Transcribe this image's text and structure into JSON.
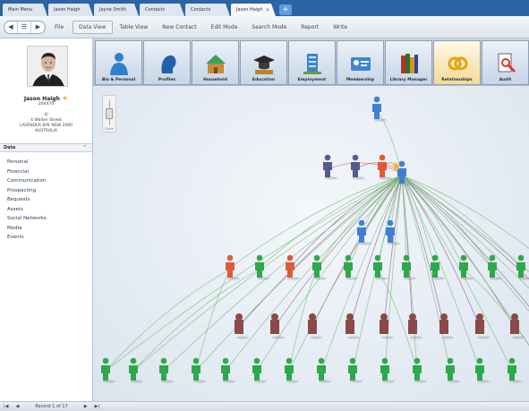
{
  "tabs": [
    {
      "label": "Main Menu",
      "active": false
    },
    {
      "label": "Jason Haigh",
      "active": false
    },
    {
      "label": "Jayne Smith",
      "active": false
    },
    {
      "label": "Contacts",
      "active": false
    },
    {
      "label": "Contacts",
      "active": false
    },
    {
      "label": "Jason Haigh",
      "active": true
    }
  ],
  "toolbar": {
    "file": "File",
    "items": [
      "Data View",
      "Table View",
      "New Contact",
      "Edit Mode",
      "Search Mode",
      "Report",
      "Write"
    ]
  },
  "person": {
    "name": "Jason Haigh",
    "id": "204470",
    "address_line1": "4/",
    "address_line2": "4 Walker Street",
    "address_line3": "LAVENDER BAY NSW 2060",
    "address_line4": "AUSTRALIA"
  },
  "data_section": {
    "header": "Data",
    "items": [
      "Personal",
      "Financial",
      "Communication",
      "Prospecting",
      "Bequests",
      "Assets",
      "Social Networks",
      "Media",
      "Events"
    ]
  },
  "ribbon": {
    "buttons": [
      {
        "label": "Bio & Personal",
        "icon": "bio-personal-icon"
      },
      {
        "label": "Profiles",
        "icon": "profiles-icon"
      },
      {
        "label": "Household",
        "icon": "household-icon"
      },
      {
        "label": "Education",
        "icon": "education-icon"
      },
      {
        "label": "Employment",
        "icon": "employment-icon"
      },
      {
        "label": "Membership",
        "icon": "membership-icon"
      },
      {
        "label": "Library Manager",
        "icon": "library-manager-icon"
      },
      {
        "label": "Relationships",
        "icon": "relationships-icon",
        "active": true
      },
      {
        "label": "Audit",
        "icon": "audit-icon"
      }
    ]
  },
  "zoom_label": "Zoom",
  "status": {
    "record": "Record 1 of 17"
  },
  "colors": {
    "person_blue": "#3f7fd6",
    "person_red": "#e05a3a",
    "person_green": "#2ea84a",
    "person_dark": "#8a4a4a",
    "person_navy": "#555a8a",
    "relationship_green": "#6bb86a",
    "relationship_purple": "#8c4c8c",
    "relationship_red": "#d05050",
    "tab_bar": "#2d64a3",
    "highlight_star": "#f2b01e"
  },
  "graph_nodes": [
    {
      "type": "person",
      "color": "blue"
    },
    {
      "type": "person",
      "color": "navy"
    },
    {
      "type": "person",
      "color": "navy"
    },
    {
      "type": "person",
      "color": "red"
    },
    {
      "type": "person",
      "color": "blue",
      "starred": true
    },
    {
      "type": "person",
      "color": "blue"
    },
    {
      "type": "person",
      "color": "blue"
    },
    {
      "type": "person",
      "color": "red"
    },
    {
      "type": "person",
      "color": "green"
    },
    {
      "type": "person",
      "color": "red"
    },
    {
      "type": "person",
      "color": "green"
    },
    {
      "type": "person",
      "color": "green"
    },
    {
      "type": "person",
      "color": "green"
    },
    {
      "type": "person",
      "color": "green"
    },
    {
      "type": "person",
      "color": "green"
    },
    {
      "type": "person",
      "color": "green"
    },
    {
      "type": "person",
      "color": "green"
    },
    {
      "type": "person",
      "color": "green"
    },
    {
      "type": "person",
      "color": "green"
    },
    {
      "type": "organisation",
      "color": "dark"
    },
    {
      "type": "organisation",
      "color": "dark"
    },
    {
      "type": "organisation",
      "color": "dark"
    },
    {
      "type": "organisation",
      "color": "dark"
    },
    {
      "type": "organisation",
      "color": "dark"
    },
    {
      "type": "organisation",
      "color": "dark"
    },
    {
      "type": "organisation",
      "color": "dark"
    },
    {
      "type": "organisation",
      "color": "dark"
    },
    {
      "type": "organisation",
      "color": "dark"
    },
    {
      "type": "organisation",
      "color": "dark"
    },
    {
      "type": "organisation",
      "color": "dark"
    },
    {
      "type": "person",
      "color": "green"
    },
    {
      "type": "person",
      "color": "green"
    },
    {
      "type": "person",
      "color": "green"
    },
    {
      "type": "person",
      "color": "green"
    },
    {
      "type": "person",
      "color": "green"
    },
    {
      "type": "person",
      "color": "green"
    },
    {
      "type": "person",
      "color": "green"
    },
    {
      "type": "person",
      "color": "green"
    },
    {
      "type": "person",
      "color": "green"
    },
    {
      "type": "person",
      "color": "green"
    },
    {
      "type": "person",
      "color": "green"
    },
    {
      "type": "person",
      "color": "green"
    },
    {
      "type": "person",
      "color": "green"
    },
    {
      "type": "person",
      "color": "green"
    },
    {
      "type": "person",
      "color": "green"
    },
    {
      "type": "person",
      "color": "green"
    },
    {
      "type": "person",
      "color": "green"
    },
    {
      "type": "person",
      "color": "green"
    }
  ],
  "graph_edges": [
    {
      "from": 0,
      "to": 4,
      "color": "green"
    },
    {
      "from": 1,
      "to": 4,
      "color": "red"
    },
    {
      "from": 2,
      "to": 4,
      "color": "red"
    },
    {
      "from": 3,
      "to": 4,
      "color": "red"
    },
    {
      "from": 4,
      "to": 5,
      "color": "green"
    },
    {
      "from": 4,
      "to": 6,
      "color": "green"
    },
    {
      "from": 4,
      "to": 7,
      "color": "green"
    },
    {
      "from": 4,
      "to": 8,
      "color": "green"
    },
    {
      "from": 4,
      "to": 9,
      "color": "purple"
    },
    {
      "from": 4,
      "to": 10,
      "color": "green"
    },
    {
      "from": 4,
      "to": 11,
      "color": "green"
    },
    {
      "from": 4,
      "to": 12,
      "color": "green"
    },
    {
      "from": 4,
      "to": 13,
      "color": "green"
    },
    {
      "from": 4,
      "to": 14,
      "color": "green"
    },
    {
      "from": 4,
      "to": 15,
      "color": "green"
    },
    {
      "from": 4,
      "to": 16,
      "color": "green"
    },
    {
      "from": 4,
      "to": 17,
      "color": "green"
    },
    {
      "from": 4,
      "to": 18,
      "color": "green"
    },
    {
      "from": 4,
      "to": 19,
      "color": "purple"
    },
    {
      "from": 4,
      "to": 20,
      "color": "purple"
    },
    {
      "from": 4,
      "to": 21,
      "color": "purple"
    },
    {
      "from": 4,
      "to": 22,
      "color": "purple"
    },
    {
      "from": 4,
      "to": 23,
      "color": "purple"
    },
    {
      "from": 4,
      "to": 24,
      "color": "purple"
    },
    {
      "from": 4,
      "to": 25,
      "color": "purple"
    },
    {
      "from": 4,
      "to": 26,
      "color": "purple"
    },
    {
      "from": 4,
      "to": 27,
      "color": "purple"
    },
    {
      "from": 4,
      "to": 28,
      "color": "purple"
    },
    {
      "from": 4,
      "to": 29,
      "color": "purple"
    },
    {
      "from": 4,
      "to": 30,
      "color": "green"
    },
    {
      "from": 4,
      "to": 31,
      "color": "green"
    },
    {
      "from": 4,
      "to": 32,
      "color": "green"
    },
    {
      "from": 4,
      "to": 33,
      "color": "green"
    },
    {
      "from": 4,
      "to": 34,
      "color": "green"
    },
    {
      "from": 4,
      "to": 35,
      "color": "green"
    },
    {
      "from": 4,
      "to": 36,
      "color": "green"
    },
    {
      "from": 4,
      "to": 37,
      "color": "green"
    },
    {
      "from": 4,
      "to": 38,
      "color": "green"
    },
    {
      "from": 4,
      "to": 39,
      "color": "green"
    },
    {
      "from": 4,
      "to": 40,
      "color": "green"
    },
    {
      "from": 4,
      "to": 41,
      "color": "green"
    },
    {
      "from": 4,
      "to": 42,
      "color": "green"
    },
    {
      "from": 4,
      "to": 43,
      "color": "green"
    },
    {
      "from": 4,
      "to": 44,
      "color": "green"
    },
    {
      "from": 4,
      "to": 45,
      "color": "green"
    },
    {
      "from": 4,
      "to": 46,
      "color": "green"
    },
    {
      "from": 4,
      "to": 47,
      "color": "green"
    },
    {
      "from": 7,
      "to": 30,
      "color": "green"
    },
    {
      "from": 7,
      "to": 33,
      "color": "green"
    },
    {
      "from": 8,
      "to": 31,
      "color": "green"
    },
    {
      "from": 10,
      "to": 36,
      "color": "green"
    },
    {
      "from": 12,
      "to": 40,
      "color": "green"
    },
    {
      "from": 15,
      "to": 44,
      "color": "green"
    }
  ]
}
